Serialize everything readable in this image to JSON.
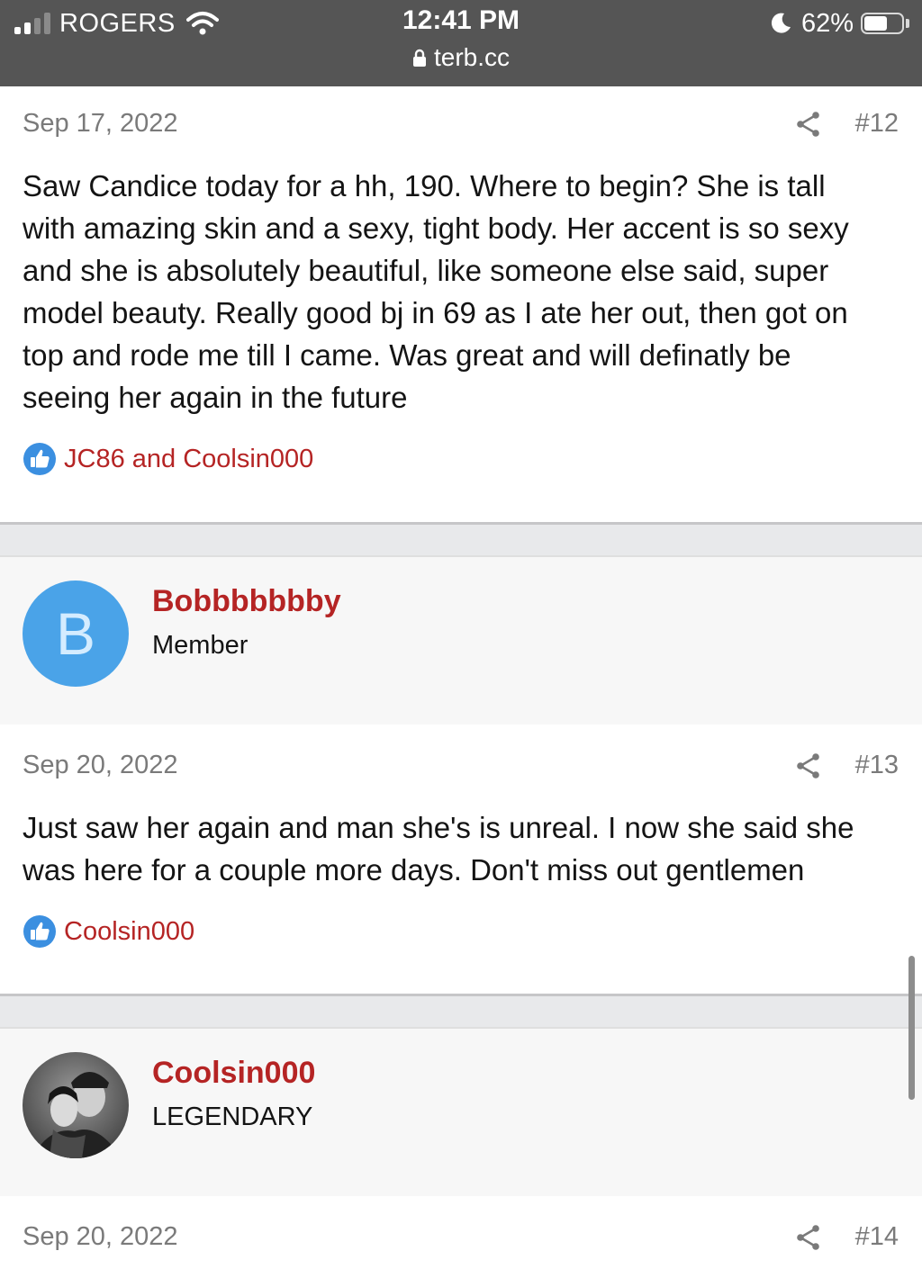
{
  "status_bar": {
    "carrier": "ROGERS",
    "time": "12:41 PM",
    "url": "terb.cc",
    "battery_percent": "62%",
    "battery_level": 0.62
  },
  "posts": [
    {
      "date": "Sep 17, 2022",
      "number": "#12",
      "lines": [
        "Saw Candice today for a hh, 190. Where to begin? She is tall",
        "with amazing skin and a sexy, tight body. Her accent is so sexy",
        "and she is absolutely beautiful, like someone else said, super",
        "model beauty. Really good bj in 69 as I ate her out, then got on",
        "top and rode me till I came. Was great and will definatly be",
        "seeing her again in the future"
      ],
      "reactions": "JC86 and Coolsin000"
    },
    {
      "author": {
        "avatar_letter": "B",
        "name": "Bobbbbbbby",
        "title": "Member"
      },
      "date": "Sep 20, 2022",
      "number": "#13",
      "lines": [
        "Just saw her again and man she's is unreal. I now she said she",
        "was here for a couple more days. Don't miss out gentlemen"
      ],
      "reactions": "Coolsin000"
    },
    {
      "author": {
        "name": "Coolsin000",
        "title": "LEGENDARY"
      },
      "date": "Sep 20, 2022",
      "number": "#14"
    }
  ],
  "colors": {
    "status_bar_bg": "#555555",
    "link_red": "#b52424",
    "avatar_blue": "#4aa3e8",
    "like_blue": "#3b8fe0"
  },
  "icons": [
    "signal-icon",
    "wifi-icon",
    "lock-icon",
    "moon-icon",
    "battery-icon",
    "share-icon",
    "like-icon"
  ]
}
